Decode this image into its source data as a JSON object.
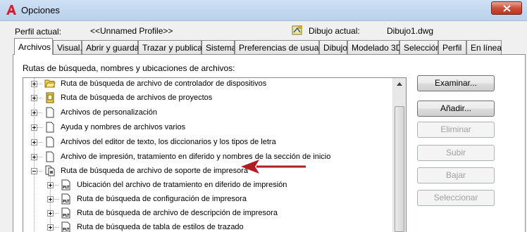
{
  "window": {
    "title": "Opciones"
  },
  "header": {
    "profile_label": "Perfil actual:",
    "profile_value": "<<Unnamed Profile>>",
    "drawing_label": "Dibujo actual:",
    "drawing_value": "Dibujo1.dwg"
  },
  "tabs": [
    {
      "label": "Archivos",
      "active": true
    },
    {
      "label": "Visual."
    },
    {
      "label": "Abrir y guardar"
    },
    {
      "label": "Trazar y publicar"
    },
    {
      "label": "Sistema"
    },
    {
      "label": "Preferencias de usuario"
    },
    {
      "label": "Dibujo"
    },
    {
      "label": "Modelado 3D"
    },
    {
      "label": "Selección"
    },
    {
      "label": "Perfil"
    },
    {
      "label": "En línea"
    }
  ],
  "section_label": "Rutas de búsqueda, nombres y ubicaciones de archivos:",
  "tree": {
    "items": [
      {
        "label": "Ruta de búsqueda de archivo de controlador de dispositivos",
        "icon": "folder-open-icon"
      },
      {
        "label": "Ruta de búsqueda de archivos de proyectos",
        "icon": "project-icon"
      },
      {
        "label": "Archivos de personalización",
        "icon": "document-icon"
      },
      {
        "label": "Ayuda y nombres de archivos varios",
        "icon": "document-icon"
      },
      {
        "label": "Archivos del editor de texto, los diccionarios y los tipos de letra",
        "icon": "document-icon"
      },
      {
        "label": "Archivo de impresión, tratamiento en diferido y nombres de la sección de inicio",
        "icon": "document-icon"
      },
      {
        "label": "Ruta de búsqueda de archivo de soporte de impresora",
        "icon": "printer-support-icon",
        "expanded": true
      }
    ],
    "children": [
      {
        "label": "Ubicación del archivo de tratamiento en diferido de impresión",
        "icon": "plt-file-icon"
      },
      {
        "label": "Ruta de búsqueda de configuración de impresora",
        "icon": "plt-file-icon"
      },
      {
        "label": "Ruta de búsqueda de archivo de descripción de impresora",
        "icon": "plt-file-icon"
      },
      {
        "label": "Ruta de búsqueda de tabla de estilos de trazado",
        "icon": "plt-file-icon"
      }
    ],
    "plt_text": "PLT"
  },
  "buttons": {
    "examinar": "Examinar...",
    "anadir": "Añadir...",
    "eliminar": "Eliminar",
    "subir": "Subir",
    "bajar": "Bajar",
    "seleccionar": "Seleccionar"
  },
  "colors": {
    "arrow": "#b01c22",
    "title_bar": "#c4d8ef",
    "close_button": "#c9503a"
  }
}
